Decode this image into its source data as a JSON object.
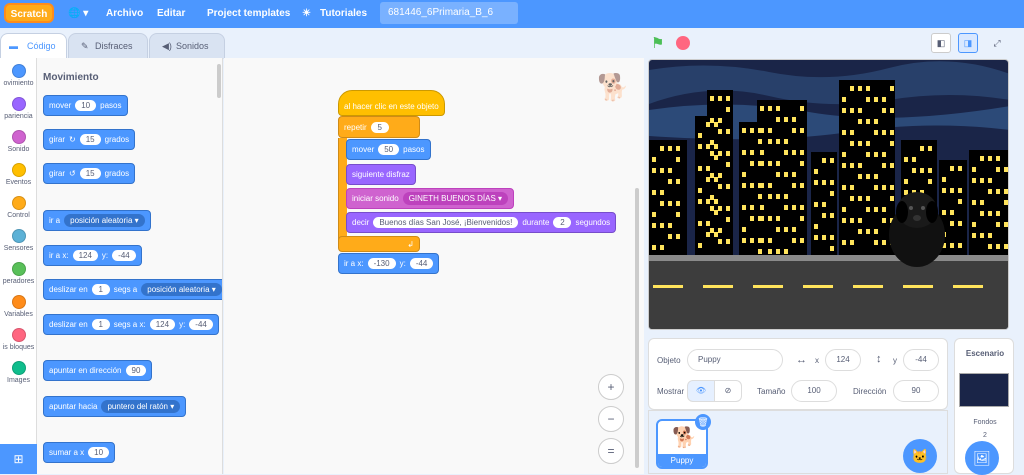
{
  "menubar": {
    "logo": "Scratch",
    "file": "Archivo",
    "edit": "Editar",
    "templates": "Project templates",
    "tutorials": "Tutoriales",
    "project_title": "681446_6Primaria_B_6"
  },
  "tabs": {
    "code": "Código",
    "costumes": "Disfraces",
    "sounds": "Sonidos"
  },
  "categories": [
    "ovimiento",
    "pariencia",
    "Sonido",
    "Eventos",
    "Control",
    "Sensores",
    "peradores",
    "Variables",
    "is bloques",
    "Images"
  ],
  "category_colors": [
    "#4c97ff",
    "#9966ff",
    "#cf63cf",
    "#ffbf00",
    "#ffab19",
    "#5cb1d6",
    "#59c059",
    "#ff8c1a",
    "#ff6680",
    "#0fbd8c"
  ],
  "palette": {
    "heading": "Movimiento",
    "move": {
      "a": "mover",
      "n": "10",
      "b": "pasos"
    },
    "turn_r": {
      "a": "girar",
      "n": "15",
      "b": "grados"
    },
    "turn_l": {
      "a": "girar",
      "n": "15",
      "b": "grados"
    },
    "goto": {
      "a": "ir a",
      "d": "posición aleatoria"
    },
    "gotoxy": {
      "a": "ir a x:",
      "x": "124",
      "y_lbl": "y:",
      "y": "-44"
    },
    "glide": {
      "a": "deslizar en",
      "n": "1",
      "b": "segs a",
      "d": "posición aleatoria"
    },
    "glidexy": {
      "a": "deslizar en",
      "n": "1",
      "b": "segs a x:",
      "x": "124",
      "y_lbl": "y:",
      "y": "-44"
    },
    "point": {
      "a": "apuntar en dirección",
      "n": "90"
    },
    "pointto": {
      "a": "apuntar hacia",
      "d": "puntero del ratón"
    },
    "changex": {
      "a": "sumar a x",
      "n": "10"
    }
  },
  "script": {
    "hat": "al hacer clic en este objeto",
    "repeat": "repetir",
    "repeat_n": "5",
    "move": "mover",
    "move_n": "50",
    "move_b": "pasos",
    "costume": "siguiente disfraz",
    "sound": "iniciar sonido",
    "sound_name": "GINETH BUENOS DÍAS",
    "say": "decir",
    "say_text": "Buenos días San José, ¡Bienvenidos!",
    "say_for": "durante",
    "say_n": "2",
    "say_b": "segundos",
    "goto": "ir a x:",
    "goto_x": "-130",
    "goto_y_lbl": "y:",
    "goto_y": "-44"
  },
  "sprite": {
    "label": "Objeto",
    "name": "Puppy",
    "x_lbl": "x",
    "x": "124",
    "y_lbl": "y",
    "y": "-44",
    "show_lbl": "Mostrar",
    "size_lbl": "Tamaño",
    "size": "100",
    "dir_lbl": "Dirección",
    "dir": "90"
  },
  "sprites": [
    {
      "name": "Puppy"
    }
  ],
  "stage_pane": {
    "title": "Escenario",
    "backdrops_lbl": "Fondos",
    "backdrops": "2"
  },
  "zoom": {
    "in": "+",
    "out": "−",
    "reset": "="
  }
}
